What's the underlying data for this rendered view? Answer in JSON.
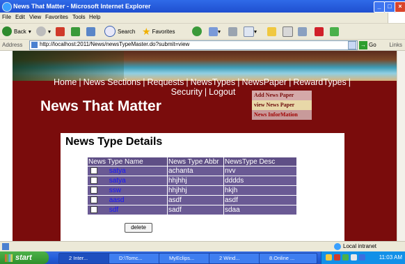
{
  "window": {
    "title": "News That Matter - Microsoft Internet Explorer"
  },
  "menu": [
    "File",
    "Edit",
    "View",
    "Favorites",
    "Tools",
    "Help"
  ],
  "toolbar": {
    "back": "Back",
    "search": "Search",
    "favorites": "Favorites"
  },
  "address": {
    "label": "Address",
    "url": "http://localhost:2011/News/newsTypeMaster.do?submit=view",
    "go": "Go",
    "links": "Links"
  },
  "nav": {
    "home": "Home",
    "sections": "News Sections",
    "requests": "Requests",
    "types": "NewsTypes",
    "paper": "NewsPaper",
    "reward": "RewardTypes",
    "security": "Security",
    "logout": "Logout"
  },
  "dropdown": [
    "Add News Paper",
    "view News Paper",
    "News InforMation"
  ],
  "site_title": "News That Matter",
  "panel": {
    "heading": "News Type Details",
    "headers": [
      "News Type Name",
      "News Type Abbr",
      "NewsType Desc"
    ],
    "rows": [
      {
        "name": "satya",
        "abbr": "achanta",
        "desc": "nvv"
      },
      {
        "name": "satya",
        "abbr": "hhjhhj",
        "desc": "dddds"
      },
      {
        "name": "ssw",
        "abbr": "hhjhhj",
        "desc": "hkjh"
      },
      {
        "name": "aasd",
        "abbr": "asdf",
        "desc": "asdf"
      },
      {
        "name": "sdf",
        "abbr": "sadf",
        "desc": "sdaa"
      }
    ],
    "delete": "delete"
  },
  "status": {
    "zone": "Local intranet"
  },
  "taskbar": {
    "start": "start",
    "tasks": [
      "2 Inter...",
      "D:\\Tomc...",
      "MyEclips...",
      "2 Wind...",
      "8.Online ..."
    ],
    "clock": "11:03 AM"
  }
}
